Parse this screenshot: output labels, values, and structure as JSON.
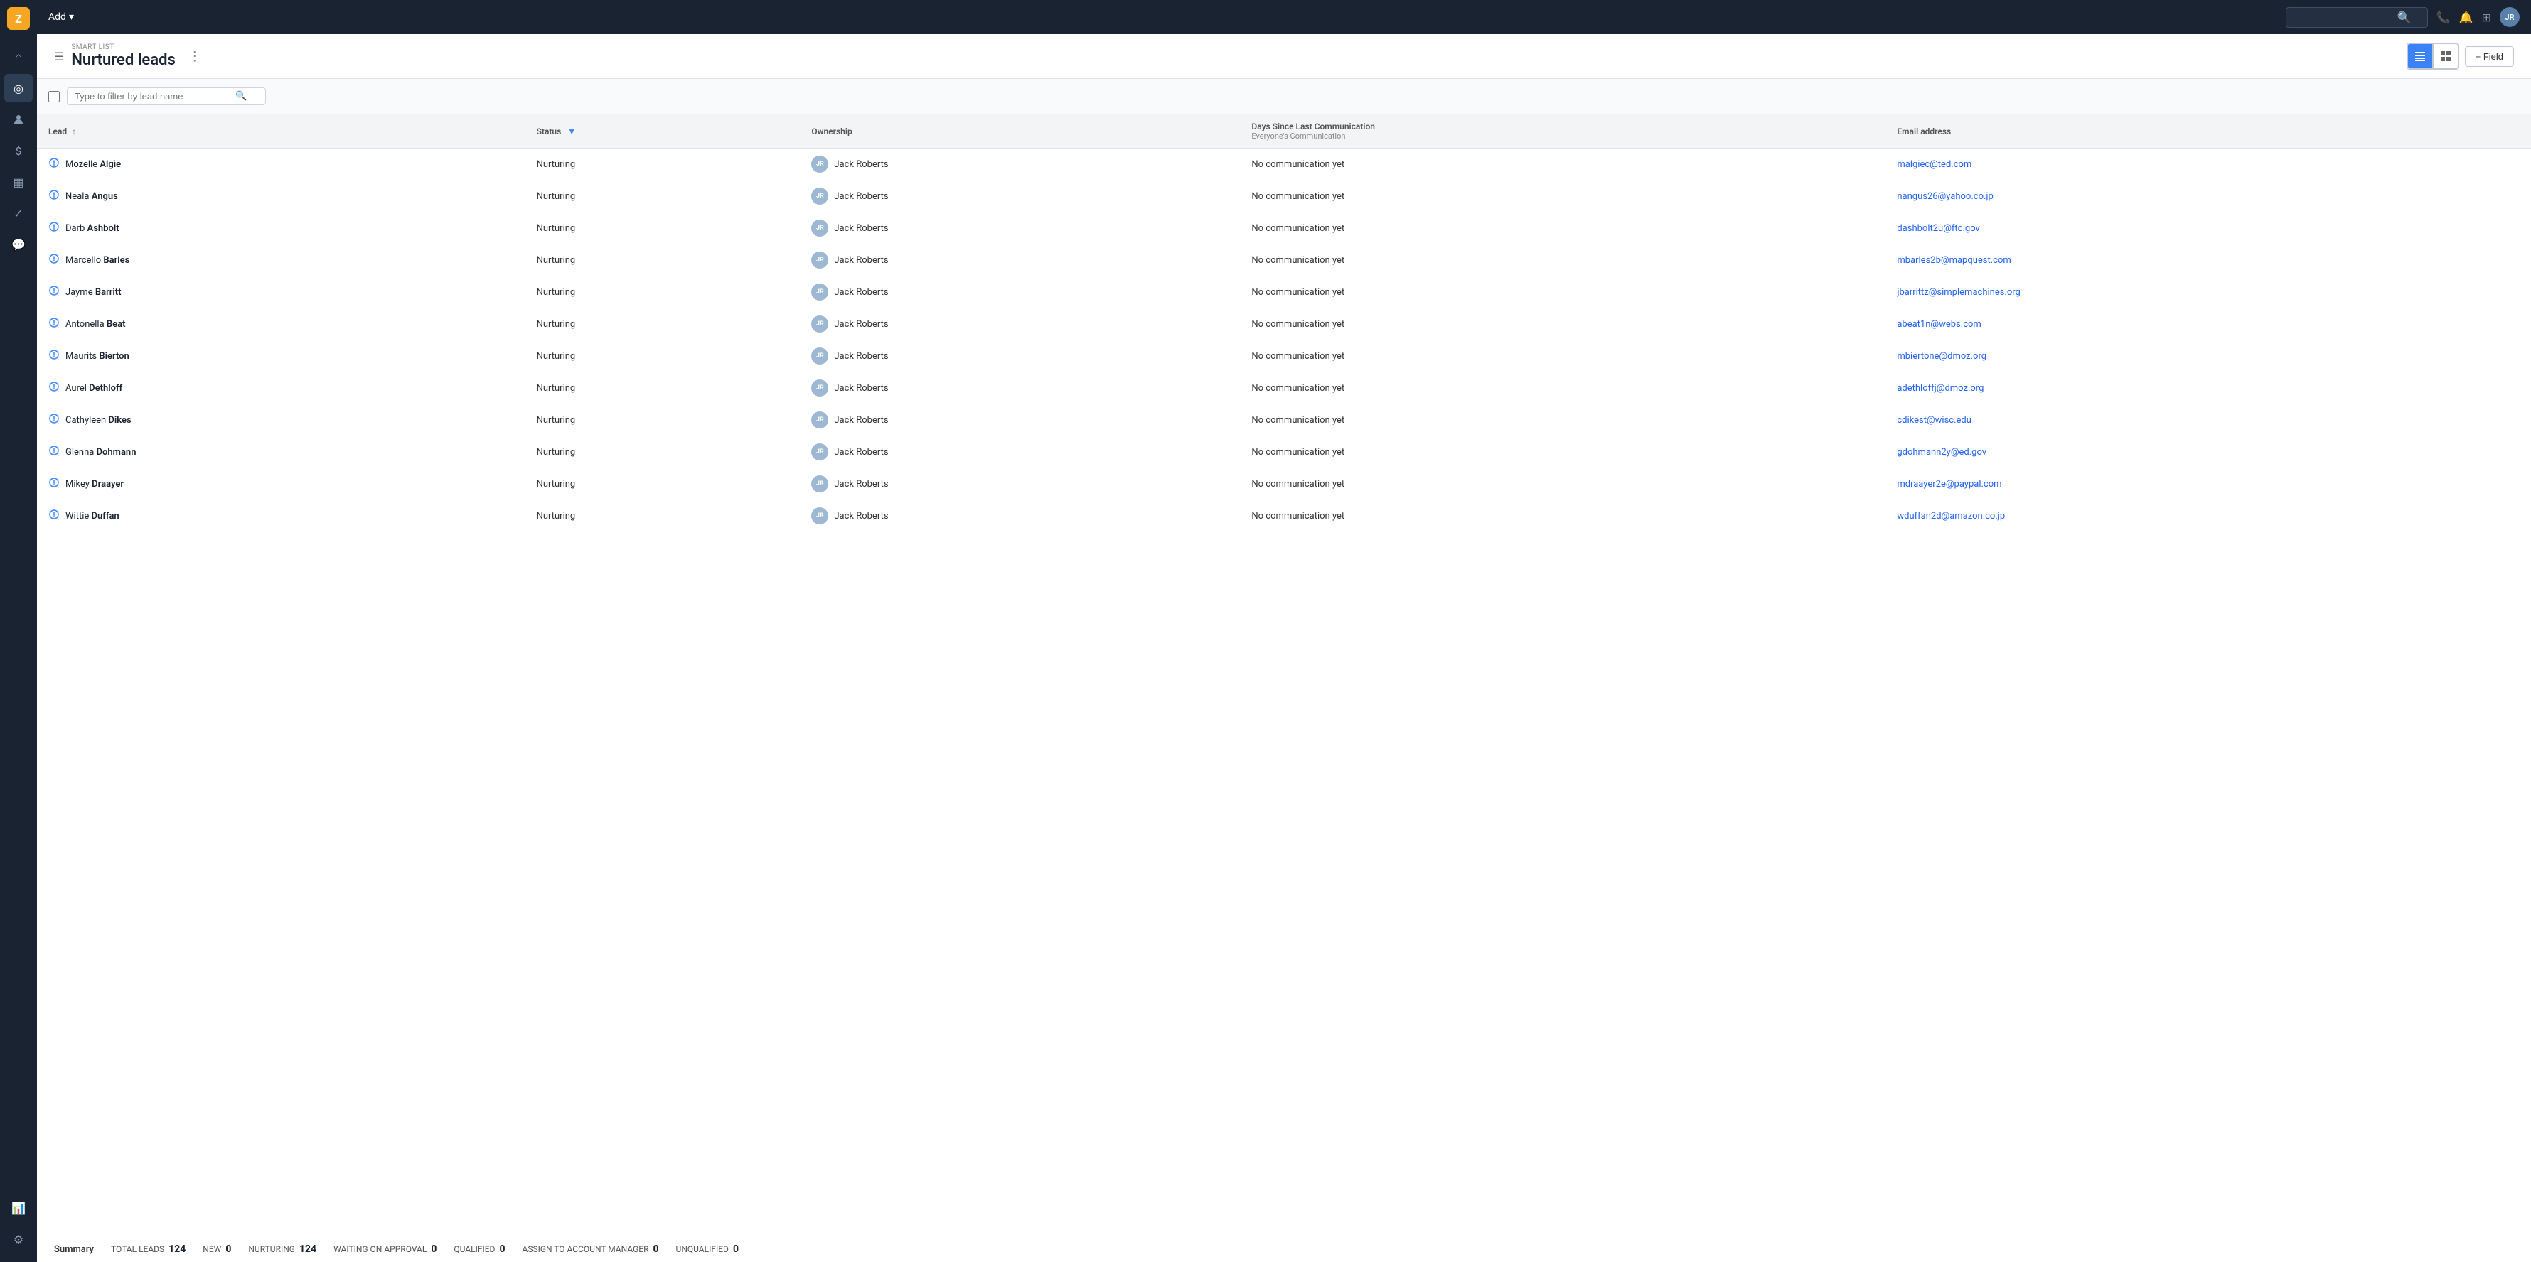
{
  "app": {
    "logo": "Z",
    "topnav": {
      "add_label": "Add",
      "search_placeholder": "",
      "avatar_initials": "JR"
    }
  },
  "sidebar": {
    "items": [
      {
        "id": "home",
        "icon": "⌂",
        "active": false
      },
      {
        "id": "leads",
        "icon": "◎",
        "active": true
      },
      {
        "id": "contacts",
        "icon": "👤",
        "active": false
      },
      {
        "id": "money",
        "icon": "$",
        "active": false
      },
      {
        "id": "dashboard",
        "icon": "▦",
        "active": false
      },
      {
        "id": "tasks",
        "icon": "✓",
        "active": false
      },
      {
        "id": "messages",
        "icon": "💬",
        "active": false
      },
      {
        "id": "reports",
        "icon": "📊",
        "active": false
      },
      {
        "id": "settings",
        "icon": "⚙",
        "active": false
      }
    ]
  },
  "page": {
    "smart_list_label": "SMART LIST",
    "title": "Nurtured leads",
    "buttons": {
      "list_view": "≡",
      "grid_view": "⊞",
      "add_field": "+ Field"
    }
  },
  "filter": {
    "placeholder": "Type to filter by lead name"
  },
  "table": {
    "columns": [
      {
        "id": "lead",
        "label": "Lead",
        "sort": true
      },
      {
        "id": "status",
        "label": "Status",
        "filter": true
      },
      {
        "id": "ownership",
        "label": "Ownership"
      },
      {
        "id": "days_since",
        "label": "Days Since Last Communication",
        "sub_label": "Everyone's Communication"
      },
      {
        "id": "email",
        "label": "Email address"
      }
    ],
    "rows": [
      {
        "id": 1,
        "first": "Mozelle",
        "last": "Algie",
        "status": "Nurturing",
        "owner_initials": "JR",
        "owner_name": "Jack Roberts",
        "communication": "No communication yet",
        "email": "malgiec@ted.com"
      },
      {
        "id": 2,
        "first": "Neala",
        "last": "Angus",
        "status": "Nurturing",
        "owner_initials": "JR",
        "owner_name": "Jack Roberts",
        "communication": "No communication yet",
        "email": "nangus26@yahoo.co.jp"
      },
      {
        "id": 3,
        "first": "Darb",
        "last": "Ashbolt",
        "status": "Nurturing",
        "owner_initials": "JR",
        "owner_name": "Jack Roberts",
        "communication": "No communication yet",
        "email": "dashbolt2u@ftc.gov"
      },
      {
        "id": 4,
        "first": "Marcello",
        "last": "Barles",
        "status": "Nurturing",
        "owner_initials": "JR",
        "owner_name": "Jack Roberts",
        "communication": "No communication yet",
        "email": "mbarles2b@mapquest.com"
      },
      {
        "id": 5,
        "first": "Jayme",
        "last": "Barritt",
        "status": "Nurturing",
        "owner_initials": "JR",
        "owner_name": "Jack Roberts",
        "communication": "No communication yet",
        "email": "jbarrittz@simplemachines.org"
      },
      {
        "id": 6,
        "first": "Antonella",
        "last": "Beat",
        "status": "Nurturing",
        "owner_initials": "JR",
        "owner_name": "Jack Roberts",
        "communication": "No communication yet",
        "email": "abeat1n@webs.com"
      },
      {
        "id": 7,
        "first": "Maurits",
        "last": "Bierton",
        "status": "Nurturing",
        "owner_initials": "JR",
        "owner_name": "Jack Roberts",
        "communication": "No communication yet",
        "email": "mbiertone@dmoz.org"
      },
      {
        "id": 8,
        "first": "Aurel",
        "last": "Dethloff",
        "status": "Nurturing",
        "owner_initials": "JR",
        "owner_name": "Jack Roberts",
        "communication": "No communication yet",
        "email": "adethloffj@dmoz.org"
      },
      {
        "id": 9,
        "first": "Cathyleen",
        "last": "Dikes",
        "status": "Nurturing",
        "owner_initials": "JR",
        "owner_name": "Jack Roberts",
        "communication": "No communication yet",
        "email": "cdikest@wisc.edu"
      },
      {
        "id": 10,
        "first": "Glenna",
        "last": "Dohmann",
        "status": "Nurturing",
        "owner_initials": "JR",
        "owner_name": "Jack Roberts",
        "communication": "No communication yet",
        "email": "gdohmann2y@ed.gov"
      },
      {
        "id": 11,
        "first": "Mikey",
        "last": "Draayer",
        "status": "Nurturing",
        "owner_initials": "JR",
        "owner_name": "Jack Roberts",
        "communication": "No communication yet",
        "email": "mdraayer2e@paypal.com"
      },
      {
        "id": 12,
        "first": "Wittie",
        "last": "Duffan",
        "status": "Nurturing",
        "owner_initials": "JR",
        "owner_name": "Jack Roberts",
        "communication": "No communication yet",
        "email": "wduffan2d@amazon.co.jp"
      }
    ]
  },
  "summary": {
    "label": "Summary",
    "total_leads_label": "TOTAL LEADS",
    "total_leads_count": "124",
    "new_label": "NEW",
    "new_count": "0",
    "nurturing_label": "NURTURING",
    "nurturing_count": "124",
    "waiting_label": "WAITING ON APPROVAL",
    "waiting_count": "0",
    "qualified_label": "QUALIFIED",
    "qualified_count": "0",
    "assign_label": "ASSIGN TO ACCOUNT MANAGER",
    "assign_count": "0",
    "unqualified_label": "UNQUALIFIED",
    "unqualified_count": "0"
  }
}
